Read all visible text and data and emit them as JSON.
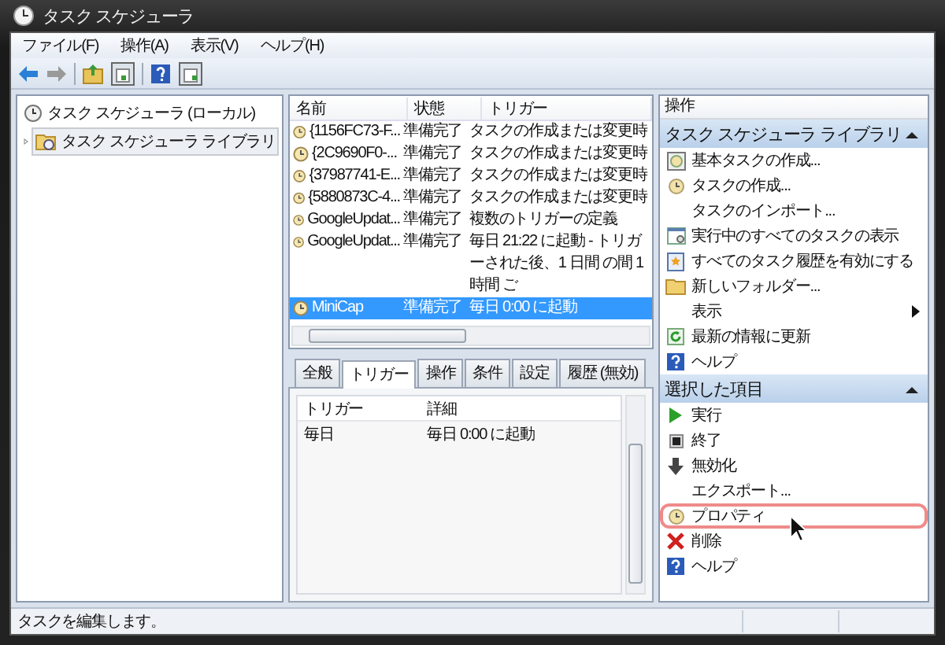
{
  "window": {
    "title": "タスク スケジューラ"
  },
  "menu": [
    "ファイル(F)",
    "操作(A)",
    "表示(V)",
    "ヘルプ(H)"
  ],
  "tree": [
    {
      "label": "タスク スケジューラ (ローカル)",
      "selected": false,
      "children": [
        {
          "label": "タスク スケジューラ ライブラリ",
          "selected": true
        }
      ]
    }
  ],
  "task_list": {
    "columns": [
      "名前",
      "状態",
      "トリガー"
    ],
    "rows": [
      {
        "name": "{1156FC73-F...",
        "status": "準備完了",
        "trigger": "タスクの作成または変更時",
        "selected": false
      },
      {
        "name": "{2C9690F0-...",
        "status": "準備完了",
        "trigger": "タスクの作成または変更時",
        "selected": false
      },
      {
        "name": "{37987741-E...",
        "status": "準備完了",
        "trigger": "タスクの作成または変更時",
        "selected": false
      },
      {
        "name": "{5880873C-4...",
        "status": "準備完了",
        "trigger": "タスクの作成または変更時",
        "selected": false
      },
      {
        "name": "GoogleUpdat...",
        "status": "準備完了",
        "trigger": "複数のトリガーの定義",
        "selected": false
      },
      {
        "name": "GoogleUpdat...",
        "status": "準備完了",
        "trigger": "毎日 21:22 に起動 - トリガーされた後、1 日間 の間 1 時間 ご",
        "selected": false
      },
      {
        "name": "MiniCap",
        "status": "準備完了",
        "trigger": "毎日 0:00 に起動",
        "selected": true
      }
    ]
  },
  "detail_tabs": [
    {
      "label": "全般",
      "selected": false
    },
    {
      "label": "トリガー",
      "selected": true
    },
    {
      "label": "操作",
      "selected": false
    },
    {
      "label": "条件",
      "selected": false
    },
    {
      "label": "設定",
      "selected": false
    },
    {
      "label": "履歴 (無効)",
      "selected": false
    }
  ],
  "trigger_table": {
    "columns": [
      "トリガー",
      "詳細"
    ],
    "rows": [
      [
        "毎日",
        "毎日 0:00 に起動"
      ]
    ]
  },
  "actions": {
    "title": "操作",
    "groups": [
      {
        "title": "タスク スケジューラ ライブラリ",
        "expanded": true,
        "items": [
          {
            "label": "基本タスクの作成...",
            "kind": "basic-task"
          },
          {
            "label": "タスクの作成...",
            "kind": "task"
          },
          {
            "label": "タスクのインポート...",
            "kind": "plain"
          },
          {
            "label": "実行中のすべてのタスクの表示",
            "kind": "running"
          },
          {
            "label": "すべてのタスク履歴を有効にする",
            "kind": "history"
          },
          {
            "label": "新しいフォルダー...",
            "kind": "folder"
          },
          {
            "label": "表示",
            "kind": "submenu"
          },
          {
            "label": "最新の情報に更新",
            "kind": "refresh"
          },
          {
            "label": "ヘルプ",
            "kind": "help"
          }
        ]
      },
      {
        "title": "選択した項目",
        "expanded": true,
        "items": [
          {
            "label": "実行",
            "kind": "run"
          },
          {
            "label": "終了",
            "kind": "stop"
          },
          {
            "label": "無効化",
            "kind": "disable"
          },
          {
            "label": "エクスポート...",
            "kind": "plain"
          },
          {
            "label": "プロパティ",
            "kind": "task",
            "highlighted": true
          },
          {
            "label": "削除",
            "kind": "delete"
          },
          {
            "label": "ヘルプ",
            "kind": "help"
          }
        ]
      }
    ]
  },
  "status_bar": "タスクを編集します。"
}
